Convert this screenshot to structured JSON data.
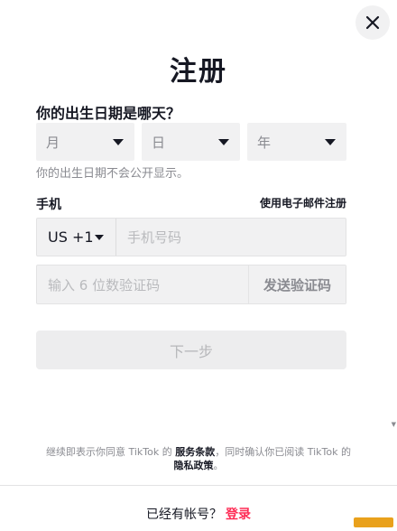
{
  "title": "注册",
  "dob": {
    "label": "你的出生日期是哪天？",
    "month_placeholder": "月",
    "day_placeholder": "日",
    "year_placeholder": "年",
    "hint": "你的出生日期不会公开显示。"
  },
  "phone": {
    "label": "手机",
    "email_link": "使用电子邮件注册",
    "country_code": "US +1",
    "placeholder": "手机号码"
  },
  "code": {
    "placeholder": "输入 6 位数验证码",
    "send_label": "发送验证码"
  },
  "next_label": "下一步",
  "terms": {
    "prefix": "继续即表示你同意 TikTok 的 ",
    "service_link": "服务条款",
    "middle": "，同时确认你已阅读 TikTok 的 ",
    "privacy_link": "隐私政策",
    "suffix": "。"
  },
  "footer": {
    "prompt": "已经有帐号？",
    "login_link": "登录"
  },
  "colors": {
    "accent": "#fe2c55",
    "field_bg": "#f1f1f2",
    "text_primary": "#161823",
    "text_secondary": "#8a8b91"
  }
}
